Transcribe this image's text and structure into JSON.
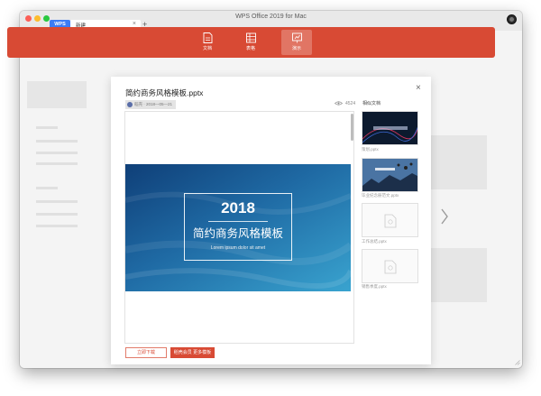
{
  "window": {
    "title": "WPS Office 2019 for Mac"
  },
  "tabs": {
    "brand": "WPS",
    "new_tab_label": "新建",
    "close_glyph": "×",
    "add_glyph": "+"
  },
  "ribbon": {
    "items": [
      {
        "label": "文档",
        "icon": "document-icon"
      },
      {
        "label": "表格",
        "icon": "spreadsheet-icon"
      },
      {
        "label": "演示",
        "icon": "presentation-icon"
      }
    ],
    "active_index": 2,
    "color": "#d84a34"
  },
  "dialog": {
    "title": "简约商务风格模板.pptx",
    "close_glyph": "×",
    "meta": "稻壳 · 2018—05—21",
    "views": "4524",
    "slide": {
      "year": "2018",
      "title": "简约商务风格模板",
      "subtitle": "Lorem ipsum dolor sit amet"
    },
    "related": {
      "title": "相似文档",
      "items": [
        {
          "caption": "策划.pptx"
        },
        {
          "caption": "毕业纪念册范文.pptx"
        },
        {
          "caption": "工作总结.pptx"
        },
        {
          "caption": "销售季度.pptx"
        }
      ]
    },
    "buttons": {
      "download": "立即下载",
      "vip": "稻壳会员 更多模板"
    }
  }
}
